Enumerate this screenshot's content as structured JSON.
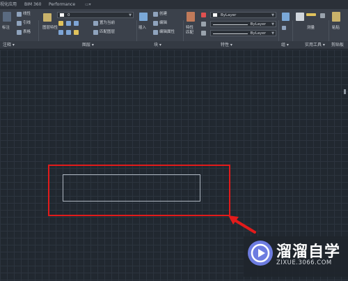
{
  "tabs": [
    "视化应用",
    "BIM 360",
    "Performance"
  ],
  "ribbon": {
    "draw": {
      "linear": "线性",
      "leader": "引线",
      "table": "表格",
      "annotate": "标注"
    },
    "layers": {
      "layer_props": "图层特性",
      "layer_name": "0",
      "make_current": "置为当前",
      "match_layer": "匹配图层"
    },
    "block": {
      "insert": "插入",
      "create": "创建",
      "edit": "编辑",
      "edit_attr": "编辑属性"
    },
    "properties": {
      "match": "特性匹配",
      "color": "ByLayer",
      "linetype": "ByLayer",
      "lineweight": "ByLayer"
    },
    "utilities": {
      "measure": "测量"
    },
    "clipboard": {
      "paste": "粘贴"
    },
    "accent": "#4a90d9"
  },
  "panel_labels": {
    "annotate": "注释 ▾",
    "layers": "图层 ▾",
    "block": "块 ▾",
    "properties": "特性 ▾",
    "groups": "组 ▾",
    "utilities": "实用工具 ▾",
    "clipboard": "剪贴板"
  },
  "watermark": {
    "title": "溜溜自学",
    "url": "ZIXUE.3066.COM"
  },
  "colors": {
    "selection": "#e21b1b",
    "canvas_bg": "#212830",
    "logo": "#6d7ce0"
  }
}
